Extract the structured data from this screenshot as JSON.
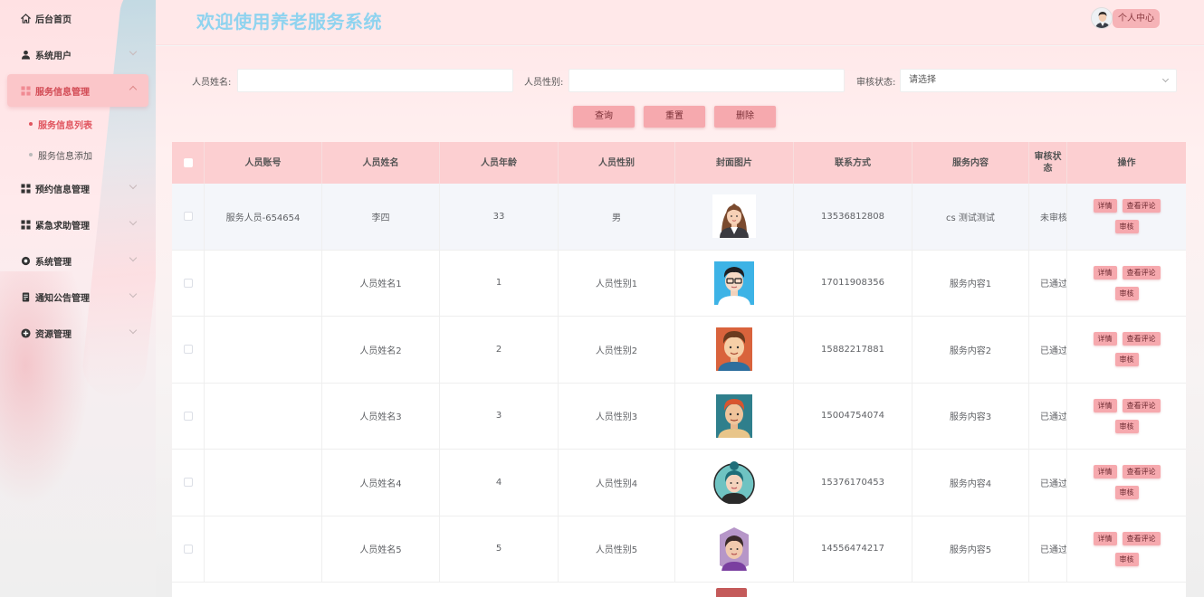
{
  "sidebar": {
    "items": [
      {
        "label": "后台首页",
        "icon": "home-icon"
      },
      {
        "label": "系统用户",
        "icon": "user-icon"
      },
      {
        "label": "服务信息管理",
        "icon": "grid-icon",
        "children": [
          {
            "label": "服务信息列表",
            "active": true
          },
          {
            "label": "服务信息添加",
            "active": false
          }
        ]
      },
      {
        "label": "预约信息管理",
        "icon": "grid-icon"
      },
      {
        "label": "紧急求助管理",
        "icon": "grid-icon"
      },
      {
        "label": "系统管理",
        "icon": "settings-icon"
      },
      {
        "label": "通知公告管理",
        "icon": "document-icon"
      },
      {
        "label": "资源管理",
        "icon": "plus-circle-icon"
      }
    ]
  },
  "header": {
    "title": "欢迎使用养老服务系统",
    "profile_button": "个人中心"
  },
  "search": {
    "name_label": "人员姓名:",
    "gender_label": "人员性别:",
    "status_label": "审核状态:",
    "status_select_value": "请选择",
    "query_button": "查询",
    "reset_button": "重置",
    "delete_button": "删除"
  },
  "table": {
    "headers": [
      "人员账号",
      "人员姓名",
      "人员年龄",
      "人员性别",
      "封面图片",
      "联系方式",
      "服务内容",
      "审核状态",
      "操作"
    ],
    "actions": {
      "detail": "详情",
      "comments": "查看评论",
      "review": "审核"
    },
    "rows": [
      {
        "account": "服务人员-654654",
        "name": "李四",
        "age": "33",
        "gender": "男",
        "phone": "13536812808",
        "content": "cs 测试测试",
        "status": "未审核",
        "cover": "woman-avatar"
      },
      {
        "account": "",
        "name": "人员姓名1",
        "age": "1",
        "gender": "人员性别1",
        "phone": "17011908356",
        "content": "服务内容1",
        "status": "已通过",
        "cover": "glasses-man-avatar"
      },
      {
        "account": "",
        "name": "人员姓名2",
        "age": "2",
        "gender": "人员性别2",
        "phone": "15882217881",
        "content": "服务内容2",
        "status": "已通过",
        "cover": "brown-hair-man-avatar"
      },
      {
        "account": "",
        "name": "人员姓名3",
        "age": "3",
        "gender": "人员性别3",
        "phone": "15004754074",
        "content": "服务内容3",
        "status": "已通过",
        "cover": "red-hair-man-avatar"
      },
      {
        "account": "",
        "name": "人员姓名4",
        "age": "4",
        "gender": "人员性别4",
        "phone": "15376170453",
        "content": "服务内容4",
        "status": "已通过",
        "cover": "teal-hair-woman-avatar"
      },
      {
        "account": "",
        "name": "人员姓名5",
        "age": "5",
        "gender": "人员性别5",
        "phone": "14556474217",
        "content": "服务内容5",
        "status": "已通过",
        "cover": "purple-woman-avatar"
      }
    ]
  },
  "colors": {
    "accent": "#f6a9ae",
    "title": "#8fd3ef",
    "active_menu": "#e0555f"
  }
}
